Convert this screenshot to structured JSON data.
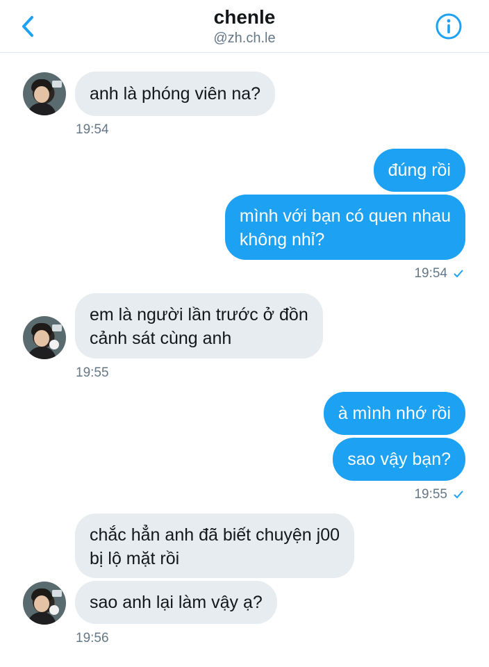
{
  "header": {
    "name": "chenle",
    "handle": "@zh.ch.le"
  },
  "messages": [
    {
      "text": "anh là phóng viên na?"
    },
    {
      "text": "đúng rồi"
    },
    {
      "line1": "mình với bạn có quen nhau",
      "line2": "không nhỉ?"
    },
    {
      "line1": "em là người lần trước ở đồn",
      "line2": "cảnh sát cùng anh"
    },
    {
      "text": "à mình nhớ rồi"
    },
    {
      "text": "sao vậy bạn?"
    },
    {
      "line1": "chắc hẳn anh đã biết chuyện j00",
      "line2": "bị lộ mặt rồi"
    },
    {
      "text": "sao anh lại làm vậy ạ?"
    }
  ],
  "timestamps": [
    "19:54",
    "19:54",
    "19:55",
    "19:55",
    "19:56"
  ],
  "colors": {
    "accent": "#1da1f2",
    "incoming_bubble": "#e6ecf0",
    "secondary_text": "#657786"
  },
  "icons": {
    "back": "chevron-left-icon",
    "info": "info-icon",
    "read_receipt": "checkmark-icon"
  }
}
